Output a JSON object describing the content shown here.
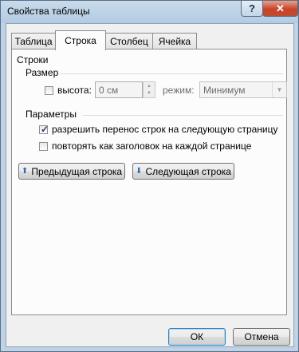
{
  "window": {
    "title": "Свойства таблицы",
    "help_label": "?",
    "close_label": "✕"
  },
  "tabs": [
    {
      "label": "Таблица"
    },
    {
      "label": "Строка"
    },
    {
      "label": "Столбец"
    },
    {
      "label": "Ячейка"
    }
  ],
  "active_tab": "Строка",
  "rows_section": {
    "heading": "Строки",
    "size": {
      "heading": "Размер",
      "height_label": "высота:",
      "height_checked": false,
      "height_value": "0 см",
      "mode_label": "режим:",
      "mode_value": "Минимум"
    },
    "params": {
      "heading": "Параметры",
      "allow_break_label": "разрешить перенос строк на следующую страницу",
      "allow_break_checked": true,
      "repeat_header_label": "повторять как заголовок на каждой странице",
      "repeat_header_checked": false
    },
    "prev_row_button": "Предыдущая строка",
    "next_row_button": "Следующая строка"
  },
  "footer": {
    "ok_label": "ОК",
    "cancel_label": "Отмена"
  },
  "icons": {
    "prev": "arrow-up-icon",
    "next": "arrow-down-icon"
  }
}
